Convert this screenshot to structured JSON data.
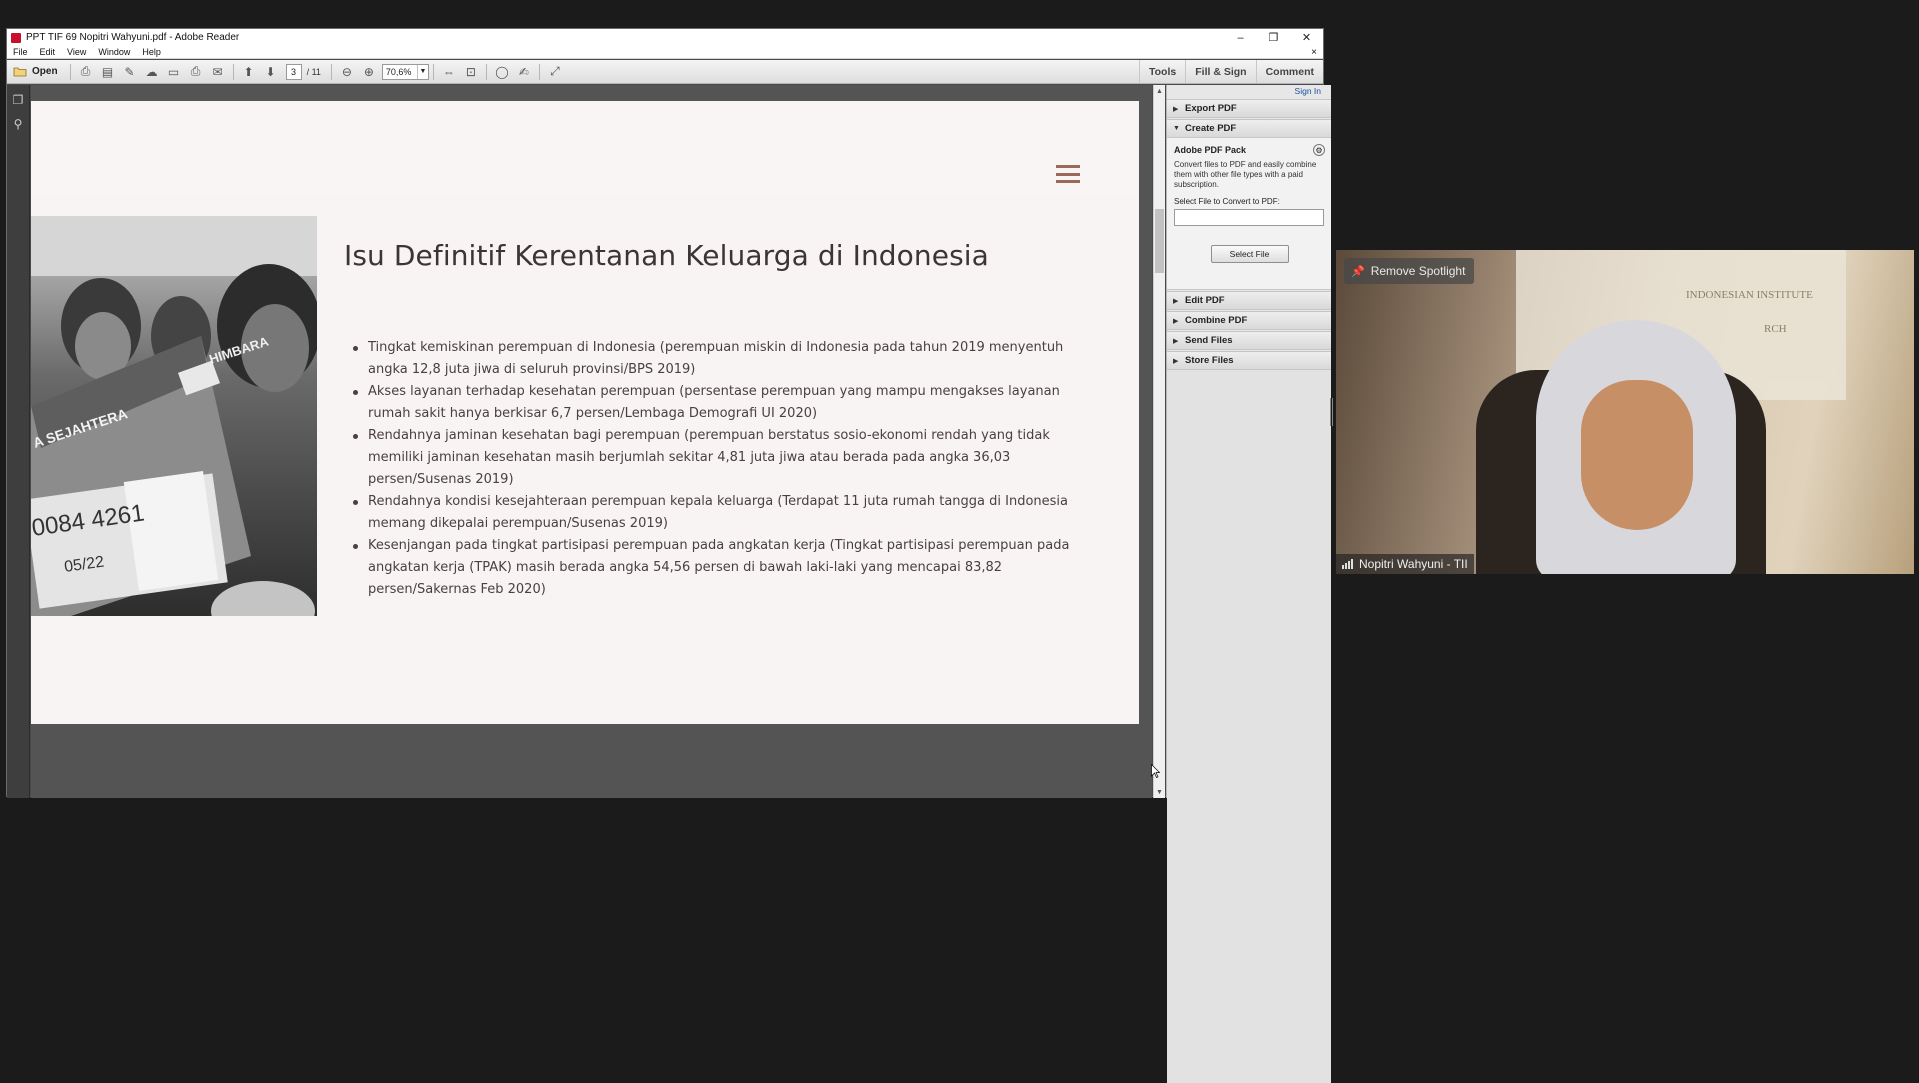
{
  "window": {
    "title": "PPT TIF 69 Nopitri Wahyuni.pdf - Adobe Reader",
    "minimize": "–",
    "restore": "❐",
    "close": "✕"
  },
  "menu": {
    "items": [
      "File",
      "Edit",
      "View",
      "Window",
      "Help"
    ],
    "close": "×"
  },
  "toolbar": {
    "open_label": "Open",
    "page_current": "3",
    "page_total": "/ 11",
    "zoom": "70,6%",
    "tools_label": "Tools",
    "fill_sign_label": "Fill & Sign",
    "comment_label": "Comment"
  },
  "slide": {
    "title": "Isu Definitif Kerentanan Keluarga di Indonesia",
    "bullets": [
      "Tingkat kemiskinan perempuan di Indonesia (perempuan miskin di Indonesia pada tahun 2019 menyentuh angka 12,8 juta jiwa di seluruh provinsi/BPS 2019)",
      "Akses layanan terhadap kesehatan perempuan (persentase perempuan yang mampu mengakses layanan rumah sakit hanya berkisar 6,7 persen/Lembaga Demografi UI 2020)",
      "Rendahnya jaminan kesehatan bagi perempuan (perempuan berstatus sosio-ekonomi rendah yang tidak memiliki jaminan kesehatan masih berjumlah sekitar 4,81 juta jiwa atau berada pada angka 36,03 persen/Susenas 2019)",
      "Rendahnya kondisi kesejahteraan perempuan kepala keluarga (Terdapat 11 juta rumah tangga di Indonesia memang dikepalai perempuan/Susenas 2019)",
      "Kesenjangan pada tingkat partisipasi perempuan pada angkatan kerja (Tingkat partisipasi perempuan pada angkatan kerja (TPAK) masih berada angka 54,56 persen di bawah laki-laki yang mencapai 83,82 persen/Sakernas Feb 2020)"
    ],
    "photo_text": {
      "brand": "HIMBARA",
      "banner": "A SEJAHTERA",
      "card_number": "0084 4261",
      "card_date": "05/22"
    },
    "accent_color": "#9c6a5a"
  },
  "tools_pane": {
    "sign_in": "Sign In",
    "export_pdf": "Export PDF",
    "create_pdf": "Create PDF",
    "pack_title": "Adobe PDF Pack",
    "pack_desc": "Convert files to PDF and easily combine them with other file types with a paid subscription.",
    "select_label": "Select File to Convert to PDF:",
    "select_button": "Select File",
    "edit_pdf": "Edit PDF",
    "combine_pdf": "Combine PDF",
    "send_files": "Send Files",
    "store_files": "Store Files"
  },
  "video": {
    "remove_spotlight": "Remove Spotlight",
    "participant_name": "Nopitri Wahyuni - TII",
    "bg_text_1": "INDONESIAN INSTITUTE",
    "bg_text_2": "RCH"
  }
}
